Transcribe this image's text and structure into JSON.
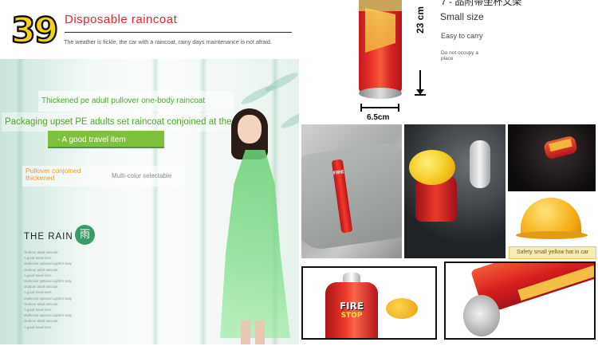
{
  "header": {
    "number": "39",
    "title": "Disposable raincoat",
    "description": "The weather is fickle, the car with a raincoat, rainy days maintenance is not afraid."
  },
  "raincoat": {
    "feature_line_1": "Thickened pe adult pullover one-body raincoat",
    "feature_line_2": "Packaging upset PE adults set raincoat conjoined at the head",
    "feature_line_3": "- A good travel item",
    "pullover_note": "Pullover conjoined thickened",
    "multicolor_note": "Multi-color selectable",
    "section_title": "THE RAIN",
    "section_badge": "雨",
    "small_list": [
      "Outdoor adult raincoat",
      "A good travel item",
      "Multicolor optional Lightfor sixty",
      "Outdoor adult raincoat",
      "A good travel item",
      "Multicolor optional Lightfor sixty",
      "Outdoor adult raincoat",
      "A good travel item",
      "Multicolor optional Lightfor sixty",
      "Outdoor adult raincoat",
      "A good travel item",
      "Multicolor optional Lightfor sixty",
      "Outdoor adult raincoat",
      "A good travel item"
    ]
  },
  "extinguisher": {
    "cn_title": "7 - 品附帯坐杯文架",
    "size_title": "Small size",
    "easy_carry": "Easy to carry",
    "no_space": "Do not occupy a place",
    "dim_height": "23 cm",
    "dim_width": "6.5cm",
    "can_fire_label": "FIRE",
    "can_stop_label": "STOP",
    "hat_caption": "Safety small yellow hat in car"
  },
  "colors": {
    "title_red": "#e0262b",
    "badge_yellow": "#f5d21a",
    "accent_green": "#7dc13d",
    "text_green": "#4ea52a",
    "note_orange": "#e89b2a",
    "rain_badge_green": "#3b9b67",
    "extinguisher_red": "#e8352a"
  }
}
